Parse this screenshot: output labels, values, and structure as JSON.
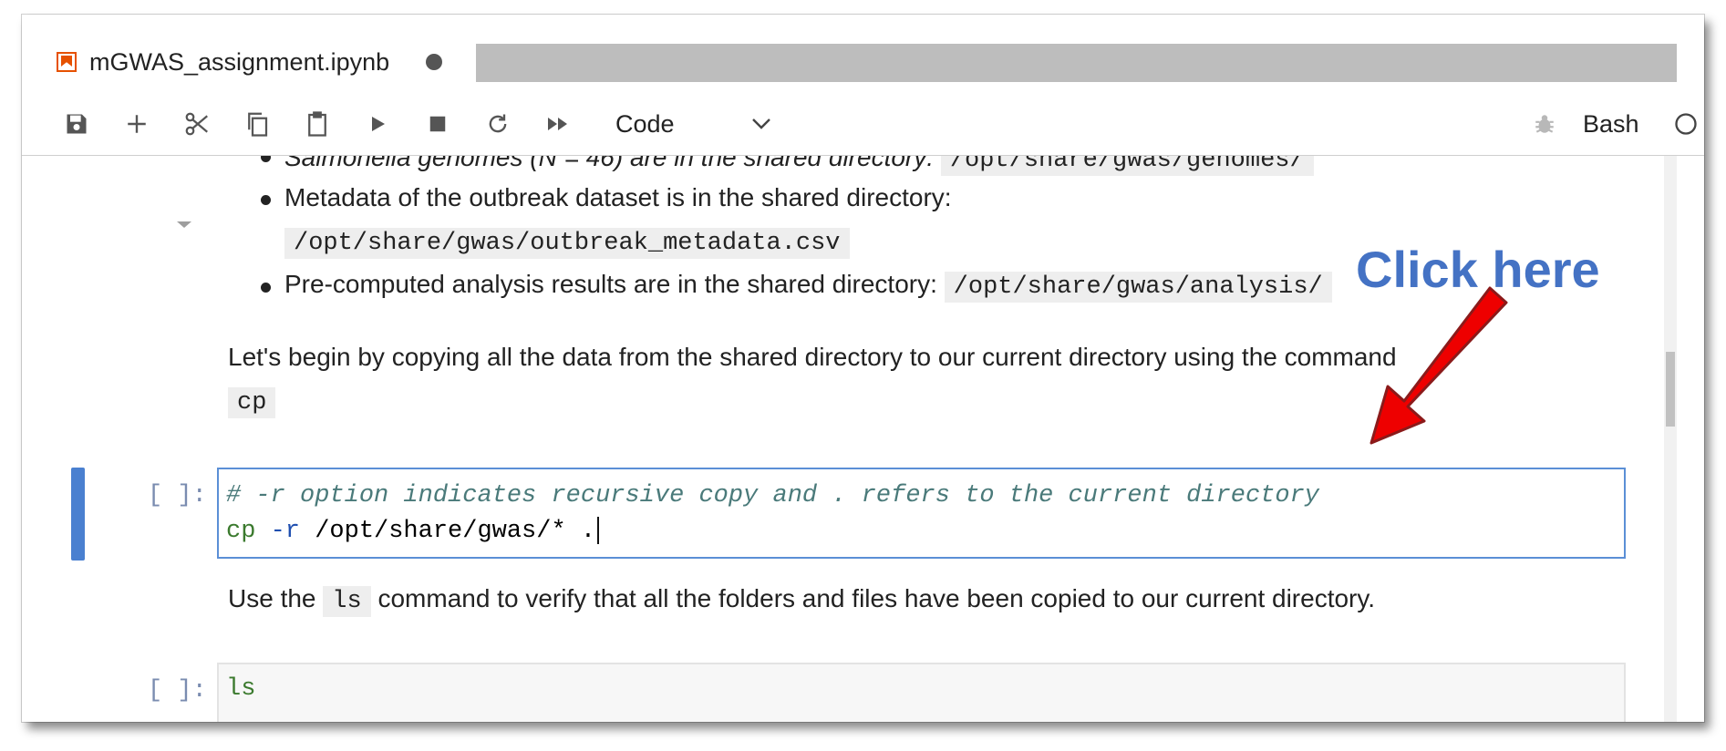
{
  "notebook_tab": {
    "title": "mGWAS_assignment.ipynb",
    "icon": "notebook-icon"
  },
  "toolbar": {
    "cell_type": "Code",
    "kernel": "Bash",
    "icons": [
      "save-icon",
      "add-icon",
      "cut-icon",
      "copy-icon",
      "paste-icon",
      "run-icon",
      "stop-icon",
      "restart-icon",
      "fast-forward-icon",
      "bug-icon",
      "kernel-status-icon"
    ]
  },
  "markdown": {
    "bullet1_prefix": "Salmonella genomes (N = 46) are in the shared directory:",
    "bullet1_code": "/opt/share/gwas/genomes/",
    "bullet2_text": "Metadata of the outbreak dataset is in the shared directory:",
    "bullet2_code": "/opt/share/gwas/outbreak_metadata.csv",
    "bullet3_text": "Pre-computed analysis results are in the shared directory:",
    "bullet3_code": "/opt/share/gwas/analysis/",
    "para1_text": "Let's begin by copying all the data from the shared directory to our current directory using the command",
    "para1_code": "cp",
    "para2_before": "Use the",
    "para2_code": "ls",
    "para2_after": "command to verify that all the folders and files have been copied to our current directory."
  },
  "cells": [
    {
      "prompt": "[ ]:",
      "comment": "# -r option indicates recursive copy and . refers to the current directory",
      "cmd": "cp",
      "flag": "-r",
      "args": "/opt/share/gwas/* ."
    },
    {
      "prompt": "[ ]:",
      "cmd": "ls"
    }
  ],
  "annotation": {
    "text": "Click here",
    "color": "#4472c4",
    "arrow_color": "#ee0000"
  }
}
